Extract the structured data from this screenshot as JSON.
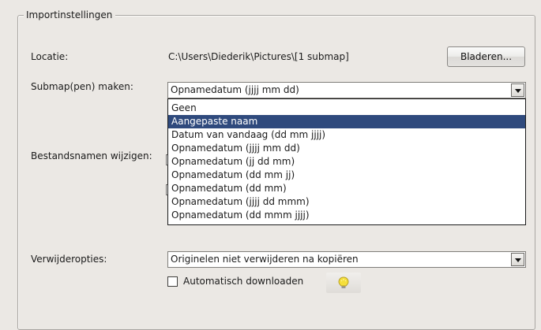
{
  "group": {
    "title": "Importinstellingen"
  },
  "location": {
    "label": "Locatie:",
    "path": "C:\\Users\\Diederik\\Pictures\\[1 submap]",
    "browse_label": "Bladeren..."
  },
  "subfolder": {
    "label": "Submap(pen) maken:",
    "selected_value": "Opnamedatum (jjjj mm dd)",
    "options": [
      "Geen",
      "Aangepaste naam",
      "Datum van vandaag (dd mm jjjj)",
      "Opnamedatum (jjjj mm dd)",
      "Opnamedatum (jj dd mm)",
      "Opnamedatum (dd mm jj)",
      "Opnamedatum (dd mm)",
      "Opnamedatum (jjjj dd mmm)",
      "Opnamedatum (dd mmm jjjj)"
    ],
    "highlighted_option": "Aangepaste naam"
  },
  "rename": {
    "label": "Bestandsnamen wijzigen:"
  },
  "delete_options": {
    "label": "Verwijderopties:",
    "selected_value": "Originelen niet verwijderen na kopiëren"
  },
  "auto_download": {
    "label": "Automatisch downloaden",
    "checked": false
  },
  "colors": {
    "background": "#ebe8e4",
    "selection": "#2f4a7d",
    "bulb": "#f5df3a"
  },
  "icons": {
    "dropdown_arrow": "chevron-down-icon",
    "tip": "lightbulb-icon"
  }
}
